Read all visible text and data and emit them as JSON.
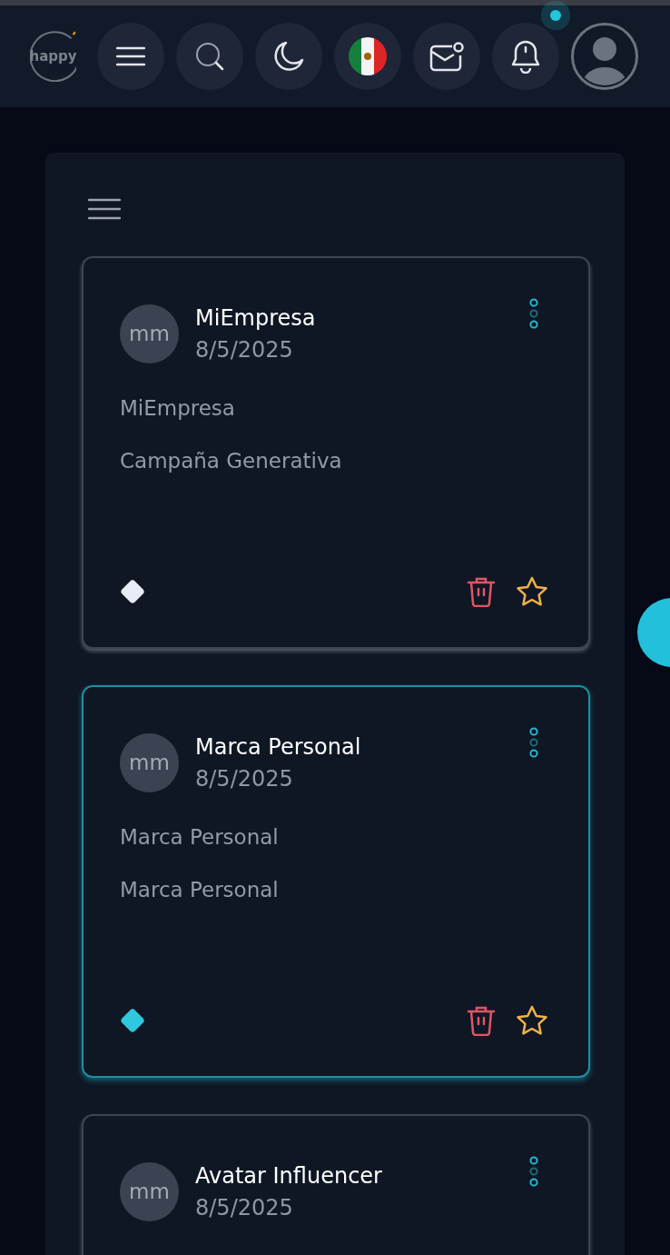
{
  "header": {
    "logo": "happy",
    "notification": {
      "unread": true
    }
  },
  "cards": [
    {
      "initials": "mm",
      "title": "MiEmpresa",
      "date": "8/5/2025",
      "lines": [
        "MiEmpresa",
        "Campaña Generativa"
      ],
      "selected": false
    },
    {
      "initials": "mm",
      "title": "Marca Personal",
      "date": "8/5/2025",
      "lines": [
        "Marca Personal",
        "Marca Personal"
      ],
      "selected": true
    },
    {
      "initials": "mm",
      "title": "Avatar Influencer",
      "date": "8/5/2025",
      "selected": false
    }
  ]
}
